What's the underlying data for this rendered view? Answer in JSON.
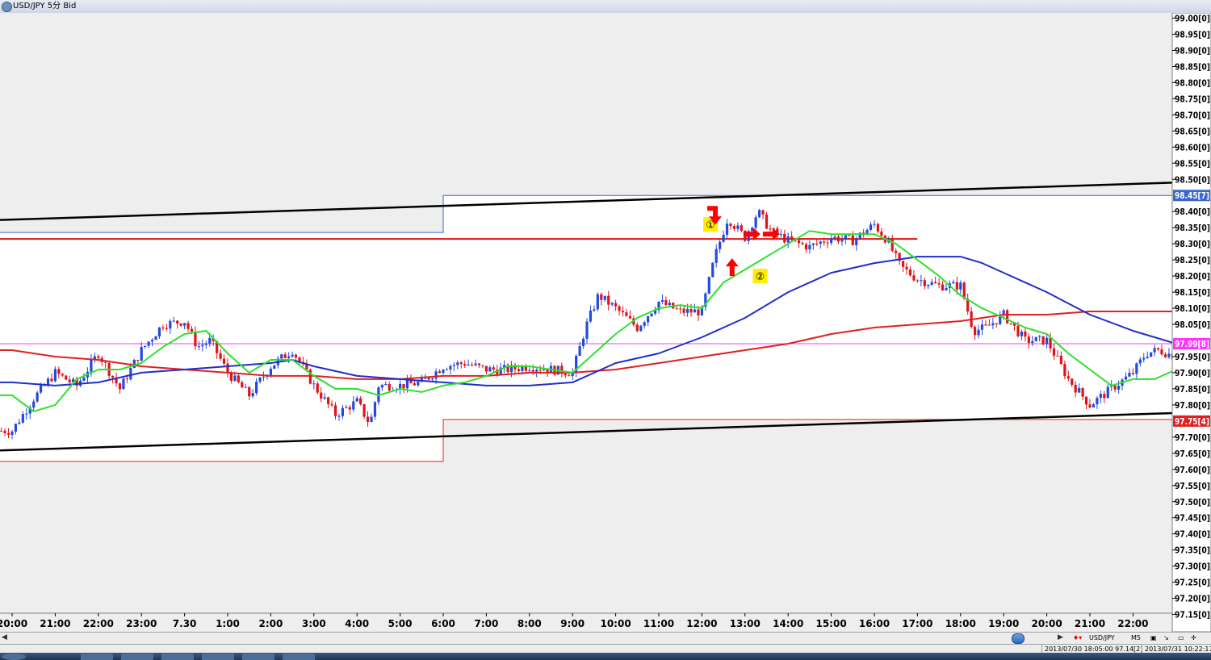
{
  "window": {
    "title": "USD/JPY 5分 Bid"
  },
  "toolbar": {
    "symbol": "USD/JPY",
    "timeframe": "M5"
  },
  "status": {
    "cursor_info": "2013/07/30 18:05:00  97.14[2]",
    "clock": "2013/07/31 10:22:17"
  },
  "colors": {
    "bull": "#2349e0",
    "bear": "#e0121a",
    "ma_short": "#2ee02e",
    "ma_mid": "#1f2fc8",
    "ma_long": "#e02020",
    "trend": "#000000",
    "resistance": "#e01010",
    "current_price_line": "#ff33ff",
    "arrow": "#ff0000",
    "marker_bg": "#ffee00"
  },
  "chart_data": {
    "type": "candlestick",
    "title": "",
    "ylim": [
      97.15,
      99.0
    ],
    "x_ticks": [
      "20:00",
      "21:00",
      "22:00",
      "23:00",
      "7.30",
      "1:00",
      "2:00",
      "3:00",
      "4:00",
      "5:00",
      "6:00",
      "7:00",
      "8:00",
      "9:00",
      "10:00",
      "11:00",
      "12:00",
      "13:00",
      "14:00",
      "15:00",
      "16:00",
      "17:00",
      "18:00",
      "19:00",
      "20:00",
      "21:00",
      "22:00"
    ],
    "y_ticks": [
      {
        "v": 99.0,
        "label": "99.00[0]"
      },
      {
        "v": 98.95,
        "label": "98.95[0]"
      },
      {
        "v": 98.9,
        "label": "98.90[0]"
      },
      {
        "v": 98.85,
        "label": "98.85[0]"
      },
      {
        "v": 98.8,
        "label": "98.80[0]"
      },
      {
        "v": 98.75,
        "label": "98.75[0]"
      },
      {
        "v": 98.7,
        "label": "98.70[0]"
      },
      {
        "v": 98.65,
        "label": "98.65[0]"
      },
      {
        "v": 98.6,
        "label": "98.60[0]"
      },
      {
        "v": 98.55,
        "label": "98.55[0]"
      },
      {
        "v": 98.5,
        "label": "98.50[0]"
      },
      {
        "v": 98.4,
        "label": "98.40[0]"
      },
      {
        "v": 98.35,
        "label": "98.35[0]"
      },
      {
        "v": 98.3,
        "label": "98.30[0]"
      },
      {
        "v": 98.25,
        "label": "98.25[0]"
      },
      {
        "v": 98.2,
        "label": "98.20[0]"
      },
      {
        "v": 98.15,
        "label": "98.15[0]"
      },
      {
        "v": 98.1,
        "label": "98.10[0]"
      },
      {
        "v": 98.05,
        "label": "98.05[0]"
      },
      {
        "v": 97.95,
        "label": "97.95[0]"
      },
      {
        "v": 97.9,
        "label": "97.90[0]"
      },
      {
        "v": 97.85,
        "label": "97.85[0]"
      },
      {
        "v": 97.8,
        "label": "97.80[0]"
      },
      {
        "v": 97.7,
        "label": "97.70[0]"
      },
      {
        "v": 97.65,
        "label": "97.65[0]"
      },
      {
        "v": 97.6,
        "label": "97.60[0]"
      },
      {
        "v": 97.55,
        "label": "97.55[0]"
      },
      {
        "v": 97.5,
        "label": "97.50[0]"
      },
      {
        "v": 97.45,
        "label": "97.45[0]"
      },
      {
        "v": 97.4,
        "label": "97.40[0]"
      },
      {
        "v": 97.35,
        "label": "97.35[0]"
      },
      {
        "v": 97.3,
        "label": "97.30[0]"
      },
      {
        "v": 97.25,
        "label": "97.25[0]"
      },
      {
        "v": 97.2,
        "label": "97.20[0]"
      },
      {
        "v": 97.15,
        "label": "97.15[0]"
      }
    ],
    "price_tags": [
      {
        "v": 98.45,
        "label": "98.45[7]",
        "color": "#3a66d0"
      },
      {
        "v": 97.99,
        "label": "97.99[8]",
        "color": "#ff33ff"
      },
      {
        "v": 97.75,
        "label": "97.75[4]",
        "color": "#e02020"
      }
    ],
    "current_price": 97.99,
    "resistance_level": 98.315,
    "trendline_upper": [
      [
        0,
        98.375
      ],
      [
        27,
        98.49
      ]
    ],
    "trendline_lower": [
      [
        0,
        97.66
      ],
      [
        27,
        97.775
      ]
    ],
    "prev_day_box": {
      "high_before": 98.335,
      "low_before": 97.625,
      "high_after": 98.45,
      "low_after": 97.755,
      "switch_x": 10
    },
    "annotation_markers": [
      {
        "label": "①",
        "x": 16.2,
        "y": 98.36
      },
      {
        "label": "②",
        "x": 17.35,
        "y": 98.2
      }
    ],
    "arrows": [
      {
        "x": 16.35,
        "y": 98.41,
        "dir": "right-down"
      },
      {
        "x": 16.7,
        "y": 98.23,
        "dir": "up"
      },
      {
        "x": 17.15,
        "y": 98.33,
        "dir": "right"
      },
      {
        "x": 17.6,
        "y": 98.33,
        "dir": "right"
      }
    ],
    "series": {
      "ma_short": [
        [
          0,
          97.83
        ],
        [
          0.5,
          97.78
        ],
        [
          1,
          97.8
        ],
        [
          1.5,
          97.88
        ],
        [
          2,
          97.91
        ],
        [
          2.5,
          97.91
        ],
        [
          3,
          97.93
        ],
        [
          3.5,
          97.98
        ],
        [
          4,
          98.02
        ],
        [
          4.5,
          98.03
        ],
        [
          5,
          97.96
        ],
        [
          5.5,
          97.9
        ],
        [
          6,
          97.94
        ],
        [
          6.5,
          97.94
        ],
        [
          7,
          97.89
        ],
        [
          7.5,
          97.85
        ],
        [
          8,
          97.85
        ],
        [
          8.5,
          97.83
        ],
        [
          9,
          97.85
        ],
        [
          9.5,
          97.84
        ],
        [
          10,
          97.86
        ],
        [
          10.5,
          97.87
        ],
        [
          11,
          97.89
        ],
        [
          11.5,
          97.92
        ],
        [
          12,
          97.92
        ],
        [
          12.5,
          97.91
        ],
        [
          13,
          97.9
        ],
        [
          13.5,
          97.96
        ],
        [
          14,
          98.02
        ],
        [
          14.5,
          98.07
        ],
        [
          15,
          98.1
        ],
        [
          15.5,
          98.11
        ],
        [
          16,
          98.1
        ],
        [
          16.5,
          98.18
        ],
        [
          17,
          98.22
        ],
        [
          17.5,
          98.26
        ],
        [
          18,
          98.3
        ],
        [
          18.5,
          98.34
        ],
        [
          19,
          98.33
        ],
        [
          19.5,
          98.33
        ],
        [
          20,
          98.33
        ],
        [
          20.5,
          98.3
        ],
        [
          21,
          98.25
        ],
        [
          21.5,
          98.2
        ],
        [
          22,
          98.14
        ],
        [
          22.5,
          98.1
        ],
        [
          23,
          98.07
        ],
        [
          23.5,
          98.04
        ],
        [
          24,
          98.02
        ],
        [
          24.5,
          97.96
        ],
        [
          25,
          97.91
        ],
        [
          25.5,
          97.86
        ],
        [
          26,
          97.88
        ],
        [
          26.5,
          97.88
        ],
        [
          27,
          97.91
        ]
      ],
      "ma_mid": [
        [
          0,
          97.87
        ],
        [
          1,
          97.86
        ],
        [
          2,
          97.87
        ],
        [
          3,
          97.9
        ],
        [
          4,
          97.91
        ],
        [
          5,
          97.92
        ],
        [
          6,
          97.93
        ],
        [
          6.5,
          97.94
        ],
        [
          7,
          97.92
        ],
        [
          8,
          97.89
        ],
        [
          9,
          97.88
        ],
        [
          10,
          97.87
        ],
        [
          11,
          97.86
        ],
        [
          12,
          97.86
        ],
        [
          13,
          97.87
        ],
        [
          14,
          97.93
        ],
        [
          15,
          97.96
        ],
        [
          16,
          98.01
        ],
        [
          17,
          98.07
        ],
        [
          18,
          98.15
        ],
        [
          19,
          98.21
        ],
        [
          20,
          98.24
        ],
        [
          20.5,
          98.25
        ],
        [
          21,
          98.26
        ],
        [
          21.5,
          98.26
        ],
        [
          22,
          98.26
        ],
        [
          22.5,
          98.24
        ],
        [
          23,
          98.21
        ],
        [
          24,
          98.15
        ],
        [
          25,
          98.08
        ],
        [
          26,
          98.03
        ],
        [
          27,
          97.99
        ]
      ],
      "ma_long": [
        [
          0,
          97.97
        ],
        [
          1,
          97.95
        ],
        [
          2,
          97.94
        ],
        [
          3,
          97.92
        ],
        [
          4,
          97.91
        ],
        [
          5,
          97.9
        ],
        [
          6,
          97.89
        ],
        [
          7,
          97.89
        ],
        [
          8,
          97.88
        ],
        [
          9,
          97.88
        ],
        [
          10,
          97.89
        ],
        [
          11,
          97.89
        ],
        [
          12,
          97.9
        ],
        [
          13,
          97.9
        ],
        [
          14,
          97.91
        ],
        [
          15,
          97.93
        ],
        [
          16,
          97.95
        ],
        [
          17,
          97.97
        ],
        [
          18,
          97.99
        ],
        [
          19,
          98.02
        ],
        [
          20,
          98.04
        ],
        [
          21,
          98.05
        ],
        [
          22,
          98.06
        ],
        [
          23,
          98.08
        ],
        [
          24,
          98.08
        ],
        [
          25,
          98.09
        ],
        [
          26,
          98.09
        ],
        [
          27,
          98.09
        ]
      ],
      "price_path": [
        [
          0,
          97.72
        ],
        [
          0.5,
          97.82
        ],
        [
          1,
          97.9
        ],
        [
          1.5,
          97.86
        ],
        [
          2,
          97.96
        ],
        [
          2.5,
          97.85
        ],
        [
          3,
          97.97
        ],
        [
          3.5,
          98.05
        ],
        [
          4,
          98.06
        ],
        [
          4.3,
          97.98
        ],
        [
          4.6,
          98.0
        ],
        [
          5,
          97.9
        ],
        [
          5.5,
          97.83
        ],
        [
          6,
          97.92
        ],
        [
          6.5,
          97.97
        ],
        [
          7,
          97.86
        ],
        [
          7.5,
          97.77
        ],
        [
          8,
          97.81
        ],
        [
          8.3,
          97.74
        ],
        [
          8.5,
          97.86
        ],
        [
          9,
          97.86
        ],
        [
          9.5,
          97.87
        ],
        [
          10,
          97.92
        ],
        [
          10.5,
          97.93
        ],
        [
          11,
          97.91
        ],
        [
          11.5,
          97.91
        ],
        [
          12,
          97.92
        ],
        [
          12.5,
          97.91
        ],
        [
          13,
          97.9
        ],
        [
          13.3,
          98.04
        ],
        [
          13.6,
          98.14
        ],
        [
          14,
          98.1
        ],
        [
          14.5,
          98.04
        ],
        [
          15,
          98.12
        ],
        [
          15.5,
          98.09
        ],
        [
          16,
          98.09
        ],
        [
          16.3,
          98.26
        ],
        [
          16.6,
          98.38
        ],
        [
          17,
          98.32
        ],
        [
          17.3,
          98.4
        ],
        [
          17.6,
          98.34
        ],
        [
          18,
          98.31
        ],
        [
          18.5,
          98.29
        ],
        [
          19,
          98.32
        ],
        [
          19.5,
          98.31
        ],
        [
          20,
          98.36
        ],
        [
          20.3,
          98.31
        ],
        [
          20.6,
          98.23
        ],
        [
          21,
          98.19
        ],
        [
          21.5,
          98.17
        ],
        [
          22,
          98.17
        ],
        [
          22.3,
          98.03
        ],
        [
          22.6,
          98.04
        ],
        [
          23,
          98.08
        ],
        [
          23.5,
          98.0
        ],
        [
          24,
          98.0
        ],
        [
          24.5,
          97.88
        ],
        [
          25,
          97.8
        ],
        [
          25.5,
          97.85
        ],
        [
          26,
          97.9
        ],
        [
          26.3,
          97.96
        ],
        [
          26.6,
          97.97
        ],
        [
          27,
          97.95
        ]
      ]
    }
  }
}
